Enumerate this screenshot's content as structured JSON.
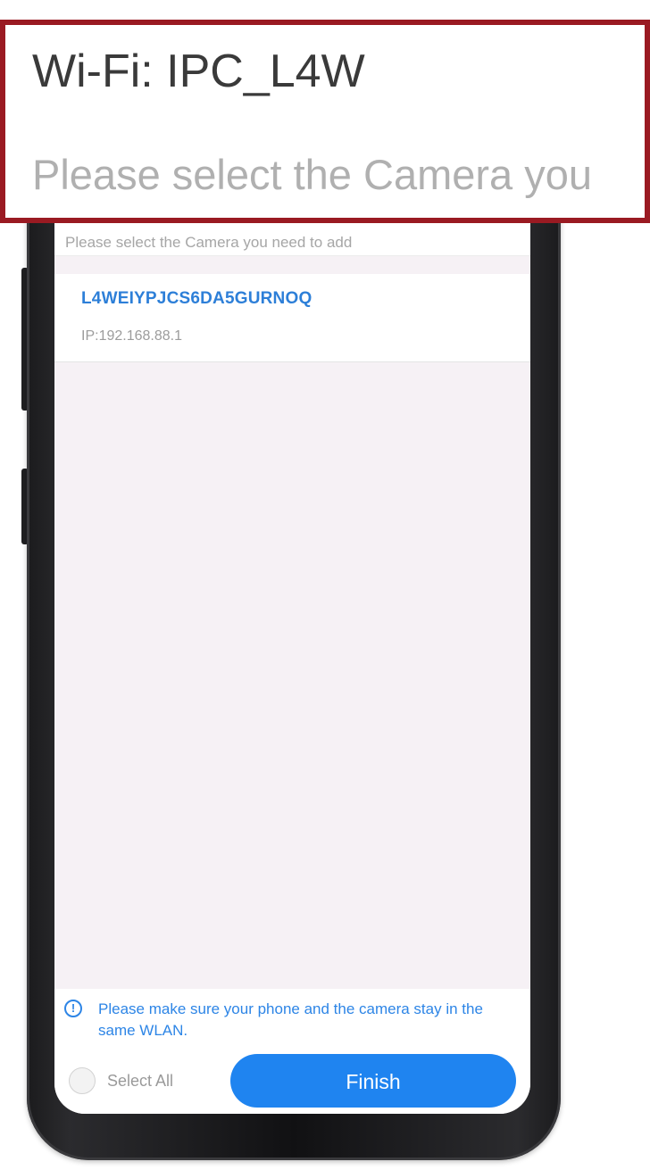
{
  "callout": {
    "wifi_label": "Wi-Fi: IPC_L4W",
    "hint_text": "Please select the Camera you"
  },
  "screen": {
    "hint_text": "Please select the Camera you need to add",
    "camera_list": [
      {
        "id": "L4WEIYPJCS6DA5GURNOQ",
        "ip": "IP:192.168.88.1"
      }
    ],
    "notice": "Please make sure your phone and the camera stay in the same WLAN.",
    "select_all_label": "Select All",
    "finish_label": "Finish"
  },
  "colors": {
    "accent": "#1f84f0",
    "link_text": "#2d7fd8",
    "callout_border": "#9a1a22",
    "screen_background": "#f6f1f5"
  },
  "icons": {
    "notice_icon": "info-icon"
  }
}
